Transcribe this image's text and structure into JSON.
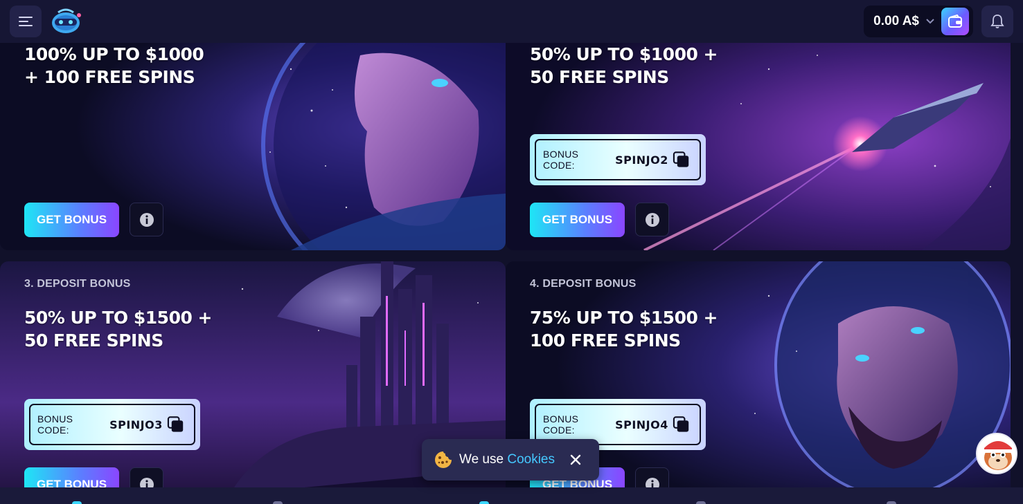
{
  "header": {
    "balance": "0.00 A$"
  },
  "cards": [
    {
      "title_line1": "100% UP TO $1000",
      "title_line2": "+ 100 FREE SPINS",
      "cta": "GET BONUS"
    },
    {
      "title_line1": "50% UP TO $1000 +",
      "title_line2": "50 FREE SPINS",
      "code_label": "BONUS CODE:",
      "code_value": "SPINJO2",
      "cta": "GET BONUS"
    },
    {
      "label": "3. DEPOSIT BONUS",
      "title_line1": "50% UP TO $1500 +",
      "title_line2": "50 FREE SPINS",
      "code_label": "BONUS CODE:",
      "code_value": "SPINJO3",
      "cta": "GET BONUS"
    },
    {
      "label": "4. DEPOSIT BONUS",
      "title_line1": "75% UP TO $1500 +",
      "title_line2": "100 FREE SPINS",
      "code_label": "BONUS CODE:",
      "code_value": "SPINJO4",
      "cta": "GET BONUS"
    }
  ],
  "cookie": {
    "prefix": "We use",
    "link": "Cookies"
  },
  "colors": {
    "background": "#11112a",
    "header": "#161634",
    "accent_cyan": "#1ee6f5",
    "accent_purple": "#8a46ff",
    "link": "#45c8ff"
  },
  "icons": [
    "menu-icon",
    "logo-icon",
    "chevron-down-icon",
    "wallet-icon",
    "bell-icon",
    "copy-icon",
    "info-icon",
    "cookie-icon",
    "close-icon",
    "support-avatar-icon"
  ]
}
